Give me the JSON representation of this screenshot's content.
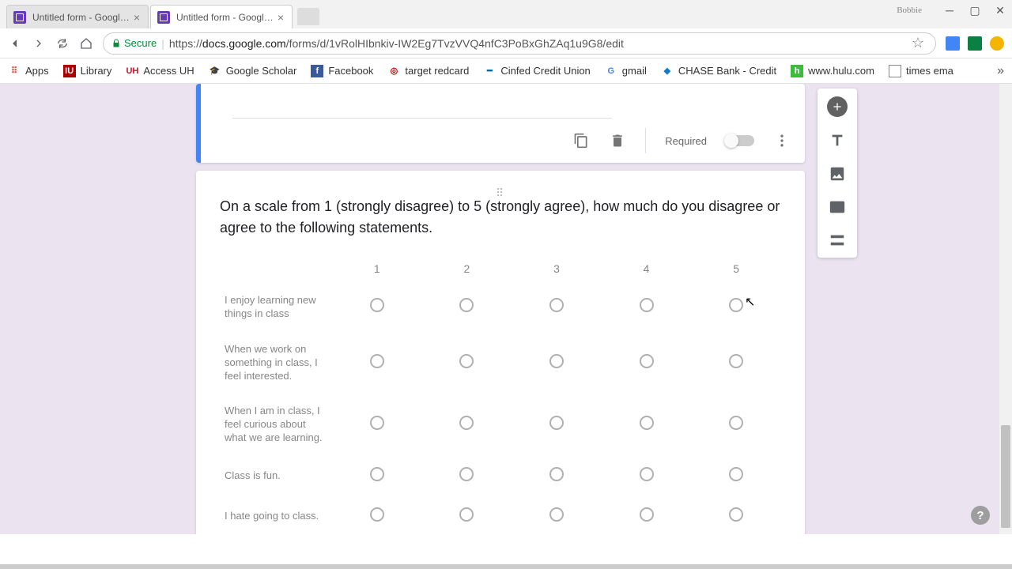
{
  "browser": {
    "tabs": [
      {
        "title": "Untitled form - Google F"
      },
      {
        "title": "Untitled form - Google F"
      }
    ],
    "profile_name": "Bobbie",
    "secure_label": "Secure",
    "url_prefix": "https://",
    "url_host": "docs.google.com",
    "url_path": "/forms/d/1vRolHIbnkiv-IW2Eg7TvzVVQ4nfC3PoBxGhZAq1u9G8/edit"
  },
  "bookmarks": [
    {
      "label": "Apps"
    },
    {
      "label": "Library"
    },
    {
      "label": "Access UH"
    },
    {
      "label": "Google Scholar"
    },
    {
      "label": "Facebook"
    },
    {
      "label": "target redcard"
    },
    {
      "label": "Cinfed Credit Union"
    },
    {
      "label": "gmail"
    },
    {
      "label": "CHASE Bank - Credit"
    },
    {
      "label": "www.hulu.com"
    },
    {
      "label": "times ema"
    }
  ],
  "form": {
    "required_label": "Required",
    "question": "On a scale from 1 (strongly disagree) to 5 (strongly agree), how much do you disagree or agree to the following statements.",
    "columns": [
      "1",
      "2",
      "3",
      "4",
      "5"
    ],
    "rows": [
      "I enjoy learning new things in class",
      "When we work on something in class, I feel interested.",
      "When I am in class, I feel curious about what we are learning.",
      "Class is fun.",
      "I hate going to class."
    ]
  },
  "help": "?"
}
